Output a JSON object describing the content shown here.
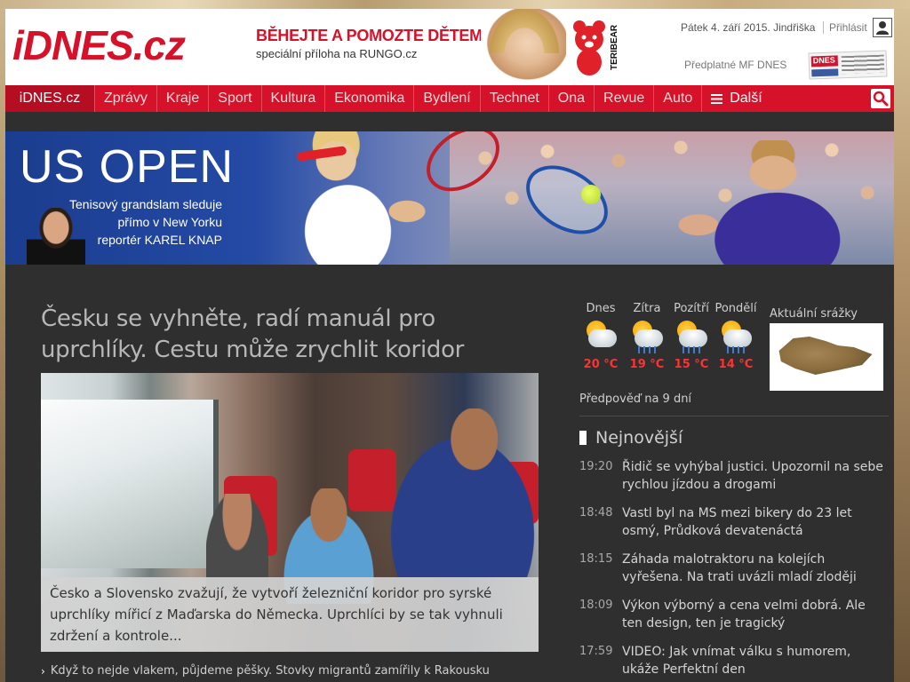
{
  "site": {
    "logo": "iDNES.cz",
    "date": "Pátek 4. září 2015. Jindřiška",
    "login": "Přihlásit",
    "subscription": "Předplatné MF DNES",
    "newspaper_mark": "DNES"
  },
  "promo": {
    "title": "BĚHEJTE A POMOZTE DĚTEM",
    "subtitle": "speciální příloha na RUNGO.cz",
    "brand": "TERIBEAR"
  },
  "nav": {
    "home": "iDNES.cz",
    "items": [
      "Zprávy",
      "Kraje",
      "Sport",
      "Kultura",
      "Ekonomika",
      "Bydlení",
      "Technet",
      "Ona",
      "Revue",
      "Auto"
    ],
    "more": "Další"
  },
  "banner": {
    "title": "US OPEN",
    "desc_line1": "Tenisový grandslam sleduje",
    "desc_line2": "přímo v New Yorku",
    "desc_line3": "reportér KAREL KNAP"
  },
  "article": {
    "headline": "Česku se vyhněte, radí manuál pro uprchlíky. Cestu může zrychlit koridor",
    "caption": "Česko a Slovensko zvažují, že vytvoří železniční koridor pro syrské uprchlíky mířicí z Maďarska do Německa. Uprchlíci by se tak vyhnuli zdržení a kontrole...",
    "related": "Když to nejde vlakem, půjdeme pěšky. Stovky migrantů zamířily k Rakousku"
  },
  "weather": {
    "days": [
      {
        "label": "Dnes",
        "temp": "20 °C"
      },
      {
        "label": "Zítra",
        "temp": "19 °C"
      },
      {
        "label": "Pozítří",
        "temp": "15 °C"
      },
      {
        "label": "Pondělí",
        "temp": "14 °C"
      }
    ],
    "rain_label": "Aktuální srážky",
    "forecast": "Předpověď na 9 dní"
  },
  "latest": {
    "title": "Nejnovější",
    "items": [
      {
        "time": "19:20",
        "text": "Řidič se vyhýbal justici. Upozornil na sebe rychlou jízdou a drogami"
      },
      {
        "time": "18:48",
        "text": "Vastl byl na MS mezi bikery do 23 let osmý, Průdková devatenáctá"
      },
      {
        "time": "18:15",
        "text": "Záhada malotraktoru na kolejích vyřešena. Na trati uvázli mladí zloději"
      },
      {
        "time": "18:09",
        "text": "Výkon výborný a cena velmi dobrá. Ale ten design, ten je tragický"
      },
      {
        "time": "17:59",
        "text": "VIDEO: Jak vnímat válku s humorem, ukáže Perfektní den"
      }
    ]
  },
  "colors": {
    "brand": "#d6122a",
    "temp": "#ff3232"
  }
}
